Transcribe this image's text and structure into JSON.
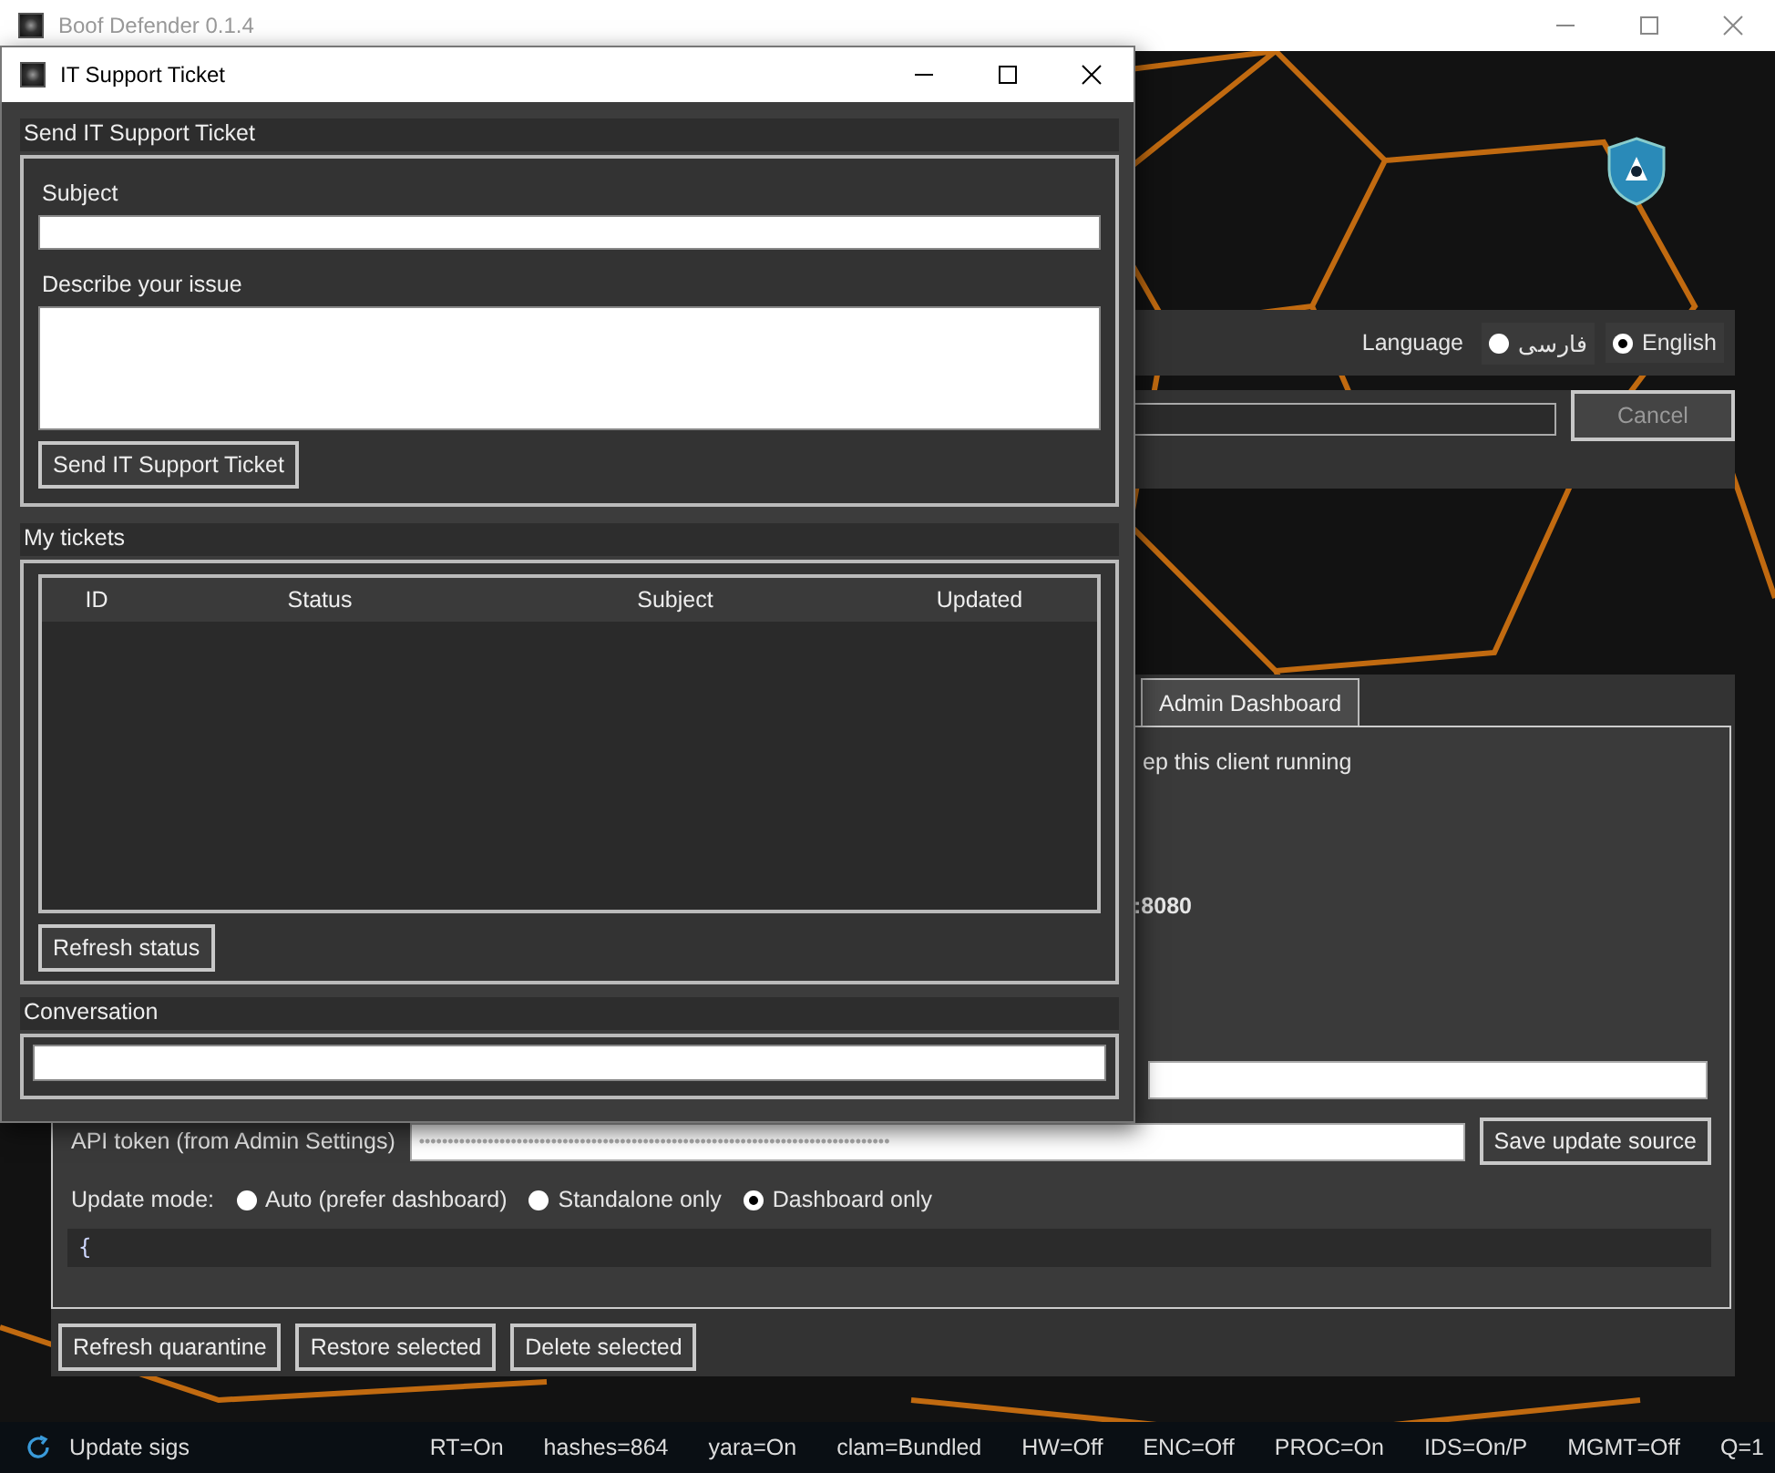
{
  "main_window": {
    "title": "Boof Defender 0.1.4",
    "language": {
      "label": "Language",
      "options": [
        {
          "label": "فارسی",
          "selected": false
        },
        {
          "label": "English",
          "selected": true
        }
      ]
    },
    "progress": {
      "level": 0,
      "cancel_button": {
        "label": "Cancel",
        "disabled": true
      }
    },
    "tabs": [
      {
        "label": "Admin Dashboard",
        "selected": false
      }
    ],
    "settings": {
      "note": "ep this client running",
      "server": ":8080",
      "api_token": {
        "label": "API token (from Admin Settings)",
        "placeholder": "••••••••••••••••••••••••••••••••••••••••••••••••••••••••••••••••••••••••••••••••••"
      },
      "save_button": "Save update source",
      "update_mode": {
        "label": "Update mode:",
        "options": [
          {
            "label": "Auto (prefer dashboard)",
            "selected": false
          },
          {
            "label": "Standalone only",
            "selected": false
          },
          {
            "label": "Dashboard only",
            "selected": true
          }
        ]
      },
      "output": "{"
    },
    "buttons": [
      "Refresh quarantine",
      "Restore selected",
      "Delete selected"
    ],
    "status_bar": {
      "action": "Update sigs",
      "items": [
        "RT=On",
        "hashes=864",
        "yara=On",
        "clam=Bundled",
        "HW=Off",
        "ENC=Off",
        "PROC=On",
        "IDS=On/P",
        "MGMT=Off",
        "Q=1"
      ]
    }
  },
  "dialog": {
    "title": "IT Support Ticket",
    "send_section": {
      "title": "Send IT Support Ticket",
      "subject_label": "Subject",
      "describe_label": "Describe your issue",
      "button": "Send IT Support Ticket"
    },
    "tickets_section": {
      "title": "My tickets",
      "columns": [
        "ID",
        "Status",
        "Subject",
        "Updated"
      ],
      "button": "Refresh status"
    },
    "conversation_section": {
      "title": "Conversation"
    }
  }
}
